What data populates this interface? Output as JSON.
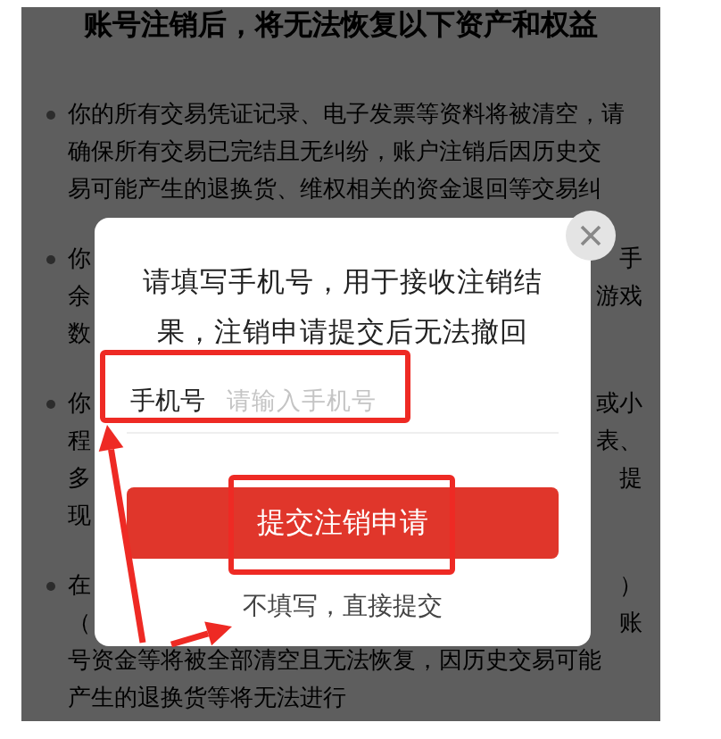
{
  "background": {
    "title": "账号注销后，将无法恢复以下资产和权益",
    "paragraphs": [
      {
        "bullet": true,
        "lines": [
          {
            "kind": "full",
            "text": "你的所有交易凭证记录、电子发票等资料将被清空，请"
          },
          {
            "kind": "full",
            "text": "确保所有交易已完结且无纠纷，账户注销后因历史交"
          },
          {
            "kind": "full",
            "text": "易可能产生的退换货、维权相关的资金退回等交易纠"
          }
        ]
      },
      {
        "bullet": true,
        "lines": [
          {
            "kind": "split",
            "left": "你",
            "right": "手"
          },
          {
            "kind": "split",
            "left": "余",
            "right": "游戏"
          },
          {
            "kind": "split",
            "left": "数"
          }
        ]
      },
      {
        "bullet": true,
        "lines": [
          {
            "kind": "split",
            "left": "你",
            "right": "或小"
          },
          {
            "kind": "split",
            "left": "程",
            "right": "表、"
          },
          {
            "kind": "split",
            "left": "多",
            "right": "提"
          },
          {
            "kind": "split",
            "left": "现"
          }
        ]
      },
      {
        "bullet": true,
        "lines": [
          {
            "kind": "split",
            "left": "在",
            "right": "）"
          },
          {
            "kind": "split",
            "left": "（",
            "right": "账"
          },
          {
            "kind": "full",
            "text": "号资金等将被全部清空且无法恢复，因历史交易可能"
          },
          {
            "kind": "full",
            "text": "产生的退换货等将无法进行"
          }
        ]
      }
    ]
  },
  "dialog": {
    "message": "请填写手机号，用于接收注销结果，注销申请提交后无法撤回",
    "phone_label": "手机号",
    "phone_placeholder": "请输入手机号",
    "submit": "提交注销申请",
    "skip": "不填写，直接提交"
  }
}
